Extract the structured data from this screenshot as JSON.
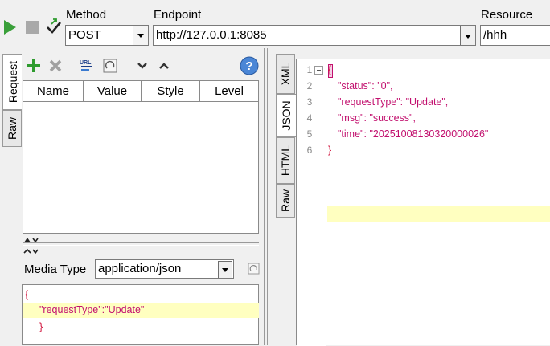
{
  "toolbar": {
    "method_label": "Method",
    "endpoint_label": "Endpoint",
    "resource_label": "Resource",
    "method_value": "POST",
    "endpoint_value": "http://127.0.0.1:8085",
    "resource_value": "/hhh"
  },
  "request_tabs": [
    "Request",
    "Raw"
  ],
  "params_table": {
    "columns": [
      "Name",
      "Value",
      "Style",
      "Level"
    ]
  },
  "media_type": {
    "label": "Media Type",
    "value": "application/json"
  },
  "request_body": {
    "open": "{",
    "key": "\"requestType\"",
    "sep": ":",
    "value": "\"Update\"",
    "close": "}"
  },
  "response_tabs": [
    "XML",
    "JSON",
    "HTML",
    "Raw"
  ],
  "response_body": {
    "line_numbers": [
      "1",
      "2",
      "3",
      "4",
      "5",
      "6"
    ],
    "open": "{",
    "close": "}",
    "lines": [
      {
        "key": "\"status\"",
        "value": "\"0\","
      },
      {
        "key": "\"requestType\"",
        "value": "\"Update\","
      },
      {
        "key": "\"msg\"",
        "value": "\"success\","
      },
      {
        "key": "\"time\"",
        "value": "\"20251008130320000026\""
      }
    ]
  },
  "icons": {
    "run": "play-icon",
    "stop": "stop-icon",
    "settings": "check-arrow-icon",
    "add": "plus-icon",
    "delete": "x-icon",
    "url": "url-icon",
    "props": "sheet-icon",
    "down": "chevron-down-icon",
    "up": "chevron-up-icon",
    "help": "help-icon"
  },
  "colors": {
    "play": "#3aa03a",
    "add": "#2e9b2e",
    "highlight": "#ffffc0",
    "json_text": "#c2106e",
    "brace": "#d0103a"
  }
}
